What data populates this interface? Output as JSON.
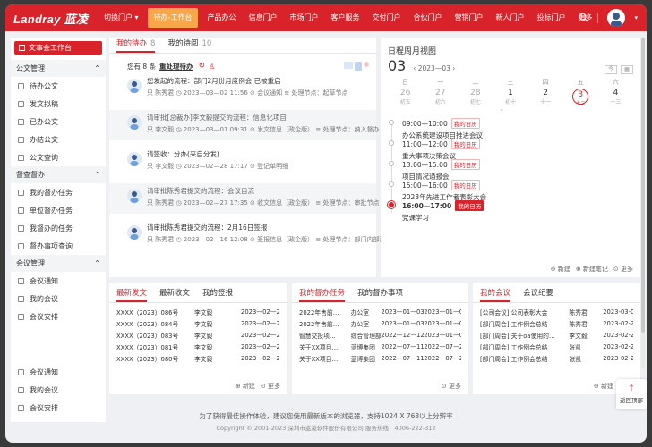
{
  "app": {
    "logo": "Landray 蓝凌"
  },
  "nav": {
    "items": [
      "切换门户 ▾",
      "待办-工作台",
      "产品办公",
      "信息门户",
      "市场门户",
      "客户服务",
      "交付门户",
      "合伙门户",
      "营销门户",
      "新人门户",
      "投标门户",
      "更多"
    ],
    "active_index": 1
  },
  "sidebar": {
    "top_button": "文事会工作台",
    "groups": [
      {
        "title": "公文管理",
        "items": [
          "待办公文",
          "发文拟稿",
          "已办公文",
          "办结公文",
          "公文查询"
        ]
      },
      {
        "title": "督查督办",
        "items": [
          "我的督办任务",
          "单位督办任务",
          "我督办的任务",
          "督办事项查询"
        ]
      },
      {
        "title": "会议管理",
        "items": [
          "会议通知",
          "我的会议",
          "会议安排"
        ]
      }
    ],
    "extra_items": [
      "会议通知",
      "我的会议",
      "会议安排"
    ]
  },
  "todo": {
    "tabs": [
      {
        "label": "我的待办",
        "count": "8"
      },
      {
        "label": "我的待阅",
        "count": "10"
      }
    ],
    "summary_prefix": "您有 8 条",
    "summary_link": "重处理待办",
    "items": [
      {
        "title": "您发起的流程：部门2月份月度例会 已被重启",
        "meta": "只 陈秀君   ◷ 2023—03—02 11:56   ⊙ 会议通知   ≡ 处理节点：起草节点",
        "gray": false
      },
      {
        "title": "请审批[总裁办]李文毅提交的流程：信息化项目",
        "meta": "只 李文毅   ◷ 2023—03—01 09:31   ⊙ 发文信息（政企版）   ≡ 处理节点：纳入督办",
        "gray": true
      },
      {
        "title": "请签收：分办(来自分发)",
        "meta": "只 李文毅   ◷ 2023—02—28 17:17   ⊙ 登记单明细",
        "gray": false
      },
      {
        "title": "请审批陈秀君提交的流程：会议自流",
        "meta": "只 陈秀君   ◷ 2023—02—27 17:35   ⊙ 收文信息（政企版）   ≡ 处理节点：审批节点",
        "gray": true
      },
      {
        "title": "请审批陈秀君提交的流程：2月16日签报",
        "meta": "只 陈秀君   ◷ 2023—02—16 12:08   ⊙ 签报信息（政企版）   ≡ 处理节点：部门内部流转",
        "gray": false
      }
    ]
  },
  "calendar": {
    "title": "日程周月视图",
    "day": "03",
    "ym": "‹ 2023—03 ›",
    "week_labels": [
      "日",
      "一",
      "二",
      "三",
      "四",
      "五",
      "六"
    ],
    "dates": [
      {
        "d": "26",
        "s": "初五",
        "dim": true
      },
      {
        "d": "27",
        "s": "初六",
        "dim": true
      },
      {
        "d": "28",
        "s": "初七",
        "dim": true
      },
      {
        "d": "1",
        "s": "初十",
        "dim": false
      },
      {
        "d": "2",
        "s": "十一",
        "dim": false
      },
      {
        "d": "3",
        "s": "十二",
        "dim": false
      },
      {
        "d": "4",
        "s": "十三",
        "dim": false
      }
    ],
    "today_index": 5,
    "events": [
      {
        "time": "09:00—10:00",
        "tag": "我的日历",
        "desc": "办公系统建设项目推进会议",
        "cur": false
      },
      {
        "time": "11:00—12:00",
        "tag": "我的日历",
        "desc": "重大事项决策会议",
        "cur": false
      },
      {
        "time": "13:00—15:00",
        "tag": "我的日历",
        "desc": "项目情况通报会",
        "cur": false
      },
      {
        "time": "15:00—16:00",
        "tag": "我的日历",
        "desc": "2023年先进工作者表彰大会",
        "cur": false
      },
      {
        "time": "16:00—17:00",
        "tag": "我的日历",
        "desc": "党课学习",
        "cur": true
      }
    ],
    "foot": [
      "⊕ 新建",
      "⊕ 新建笔记",
      "⊙ 更多"
    ]
  },
  "docs": {
    "tabs": [
      "最新发文",
      "最新收文",
      "我的签报"
    ],
    "rows": [
      [
        "XXXX（2023）086号",
        "李文毅",
        "2023—02—28"
      ],
      [
        "XXXX（2023）084号",
        "李文毅",
        "2023—02—28"
      ],
      [
        "XXXX（2023）083号",
        "李文毅",
        "2023—02—28"
      ],
      [
        "XXXX（2023）081号",
        "李文毅",
        "2023—02—26"
      ],
      [
        "XXXX（2023）080号",
        "李文毅",
        "2023—02—26"
      ]
    ],
    "foot": [
      "⊕ 新建",
      "⊙ 更多"
    ]
  },
  "supervise": {
    "tabs": [
      "我的督办任务",
      "我的督办事项"
    ],
    "rows": [
      [
        "2022年售前…",
        "办公室",
        "2023—01—03",
        "2023—01—06"
      ],
      [
        "2022年售前…",
        "办公室",
        "2023—01—03",
        "2023—01—06"
      ],
      [
        "智慧交投项…",
        "综合管理部",
        "2022—12—12",
        "2023—01—06"
      ],
      [
        "关于XX项目…",
        "蓝博集团",
        "2022—07—11",
        "2022—07—20"
      ],
      [
        "关于XX项目…",
        "蓝博集团",
        "2022—07—11",
        "2022—07—20"
      ]
    ],
    "foot": [
      "⊙ 更多"
    ]
  },
  "meetings": {
    "tabs": [
      "我的会议",
      "会议纪要"
    ],
    "rows": [
      [
        "[公司会议] 公司表彰大会",
        "陈秀君",
        "2023-03-01"
      ],
      [
        "[部门周会] 工作例会总结",
        "陈秀君",
        "2023-02-28"
      ],
      [
        "[部门周会] 关于oa使用的…",
        "李文毅",
        "2023-02-28"
      ],
      [
        "[部门周会] 工作例会总结",
        "张凯",
        "2023-02-28"
      ],
      [
        "[部门周会] 工作例会总结",
        "张凯",
        "2023-02-28"
      ]
    ],
    "foot": [
      "⊕ 新建"
    ]
  },
  "backtop": {
    "label": "返回顶部"
  },
  "footer": {
    "line1": "为了获得最佳操作体验，建议您使用最新版本的浏览器，支持1024 X 768以上分辨率",
    "line2": "Copyright © 2001-2023 深圳市蓝凌软件股份有限公司 服务热线：4006-222-312"
  }
}
